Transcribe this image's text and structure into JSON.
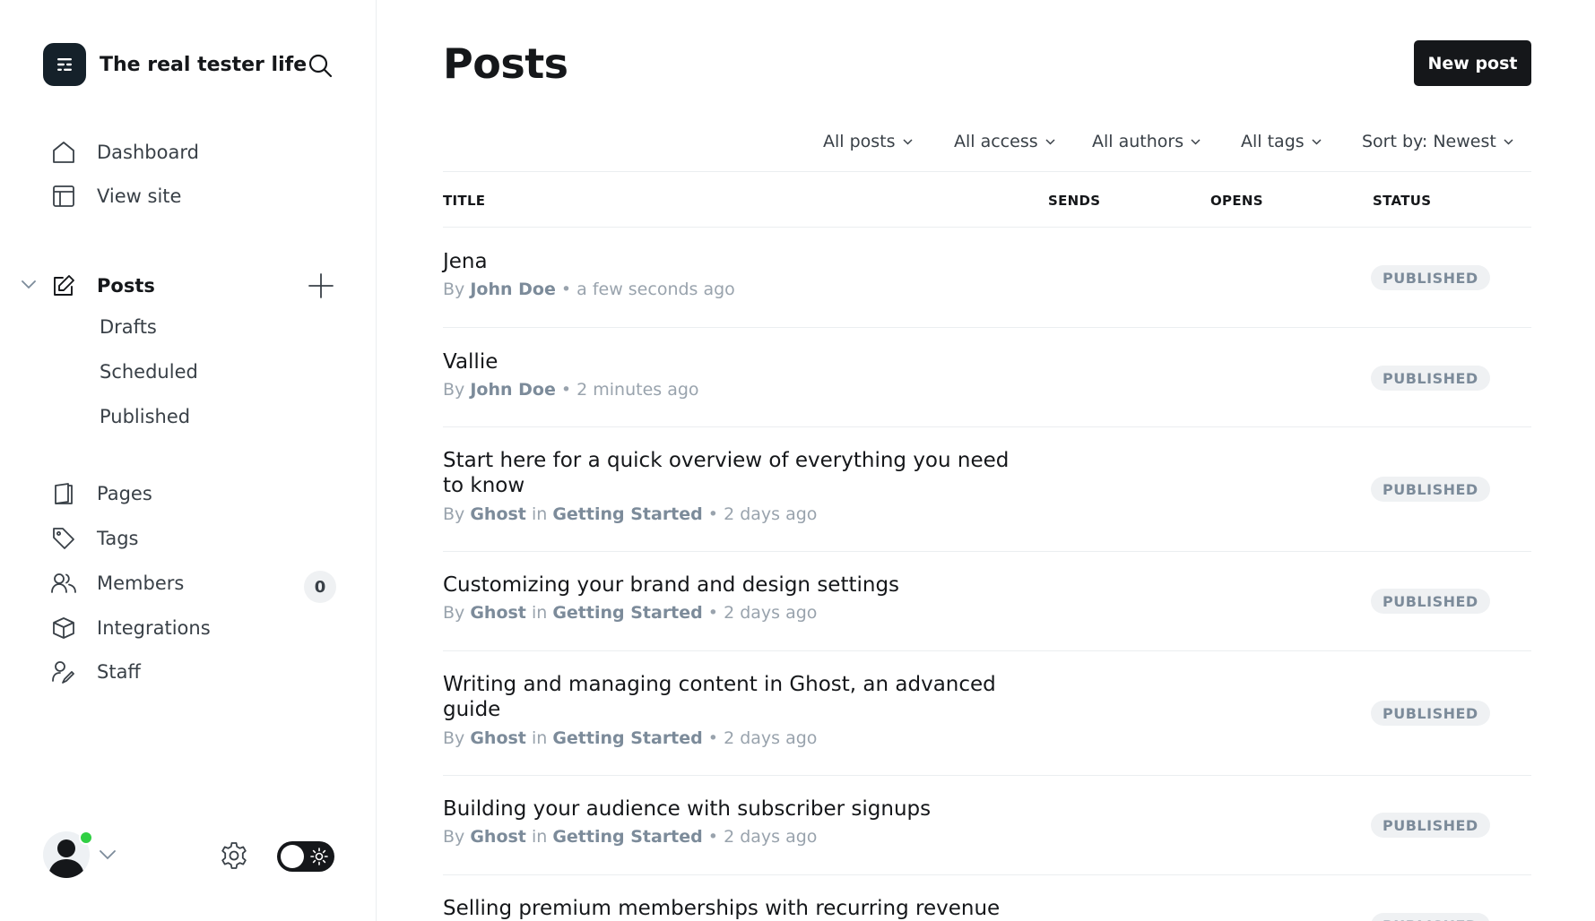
{
  "sidebar": {
    "site_title": "The real tester life",
    "icons": {
      "logo": "ghost-logo-icon",
      "search": "search-icon",
      "settings": "gear-icon"
    },
    "primary_nav": [
      {
        "label": "Dashboard",
        "icon": "home-icon"
      },
      {
        "label": "View site",
        "icon": "layout-icon"
      }
    ],
    "posts_section": {
      "label": "Posts",
      "icon": "edit-icon",
      "sub_items": [
        "Drafts",
        "Scheduled",
        "Published"
      ]
    },
    "secondary_nav": [
      {
        "label": "Pages",
        "icon": "page-icon"
      },
      {
        "label": "Tags",
        "icon": "tag-icon"
      },
      {
        "label": "Members",
        "icon": "members-icon",
        "count": "0"
      },
      {
        "label": "Integrations",
        "icon": "cube-icon"
      },
      {
        "label": "Staff",
        "icon": "staff-icon"
      }
    ]
  },
  "header": {
    "title": "Posts",
    "new_post_label": "New post"
  },
  "filters": [
    "All posts",
    "All access",
    "All authors",
    "All tags",
    "Sort by: Newest"
  ],
  "table": {
    "columns": [
      "TITLE",
      "SENDS",
      "OPENS",
      "STATUS"
    ],
    "rows": [
      {
        "title": "Jena",
        "by": "By",
        "author": "John Doe",
        "in_text": "",
        "tag": "",
        "time": "a few seconds ago",
        "status": "PUBLISHED"
      },
      {
        "title": "Vallie",
        "by": "By",
        "author": "John Doe",
        "in_text": "",
        "tag": "",
        "time": "2 minutes ago",
        "status": "PUBLISHED"
      },
      {
        "title": "Start here for a quick overview of everything you need to know",
        "by": "By",
        "author": "Ghost",
        "in_text": "in",
        "tag": "Getting Started",
        "time": "2 days ago",
        "status": "PUBLISHED"
      },
      {
        "title": "Customizing your brand and design settings",
        "by": "By",
        "author": "Ghost",
        "in_text": "in",
        "tag": "Getting Started",
        "time": "2 days ago",
        "status": "PUBLISHED"
      },
      {
        "title": "Writing and managing content in Ghost, an advanced guide",
        "by": "By",
        "author": "Ghost",
        "in_text": "in",
        "tag": "Getting Started",
        "time": "2 days ago",
        "status": "PUBLISHED"
      },
      {
        "title": "Building your audience with subscriber signups",
        "by": "By",
        "author": "Ghost",
        "in_text": "in",
        "tag": "Getting Started",
        "time": "2 days ago",
        "status": "PUBLISHED"
      },
      {
        "title": "Selling premium memberships with recurring revenue",
        "by": "",
        "author": "",
        "in_text": "",
        "tag": "",
        "time": "",
        "status": "PUBLISHED"
      }
    ]
  },
  "colors": {
    "accent": "#15171a",
    "online": "#30cf43",
    "muted_text": "#99a3ad",
    "badge_bg": "#eff1f3"
  }
}
